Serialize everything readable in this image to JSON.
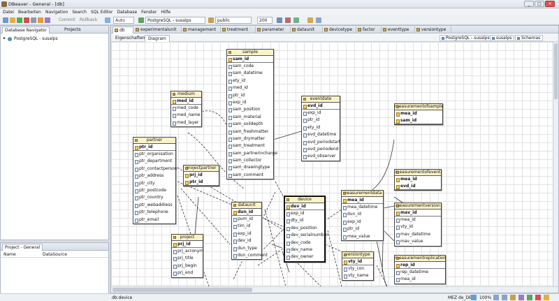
{
  "window": {
    "title": "DBeaver - General - [db]",
    "min_glyph": "_",
    "max_glyph": "□",
    "close_glyph": "×"
  },
  "menubar": [
    "Datei",
    "Bearbeiten",
    "Navigation",
    "Search",
    "SQL Editor",
    "Database",
    "Fenster",
    "Hilfe"
  ],
  "toolbar": {
    "commit_label": "Commit",
    "rollback_label": "Rollback",
    "auto_label": "Auto",
    "connection": "PostgreSQL - susalps",
    "schema": "public",
    "limit": "200"
  },
  "navigator": {
    "tabs": [
      "Database Navigator",
      "Projects"
    ],
    "tree": [
      {
        "label": "PostgreSQL - susalps"
      }
    ]
  },
  "project_panel": {
    "title": "Project - General",
    "columns": [
      "Name",
      "DataSource"
    ]
  },
  "editor": {
    "tabs": [
      "db",
      "experimentalunit",
      "management",
      "treatment",
      "parameter",
      "dataunit",
      "devicetype",
      "factor",
      "eventtype",
      "versiontype"
    ],
    "subtabs": [
      "Eigenschaften",
      "Diagram"
    ],
    "context": [
      "PostgreSQL - susalps",
      "susalps",
      "Schemas"
    ]
  },
  "diagram": {
    "entities": {
      "sample": {
        "title": "sample",
        "pk": "sam_id",
        "columns": [
          "sam_code",
          "sam_datetime",
          "ety_id",
          "med_id",
          "ptr_id",
          "exp_id",
          "sam_position",
          "sam_material",
          "sam_soildepth",
          "sam_freshmatter",
          "sam_drymatter",
          "sam_treatment",
          "sam_partnerincharge",
          "sam_collector",
          "sam_drawingtype",
          "sam_comment"
        ]
      },
      "medium": {
        "title": "medium",
        "pk": "med_id",
        "columns": [
          "med_code",
          "med_name",
          "med_layer"
        ]
      },
      "partner": {
        "title": "partner",
        "pk": "ptr_id",
        "columns": [
          "ptr_organisation",
          "ptr_department",
          "ptr_contactperson",
          "ptr_address",
          "ptr_city",
          "ptr_postcode",
          "ptr_country",
          "ptr_webaddress",
          "ptr_telephone",
          "ptr_email"
        ]
      },
      "projectpartner": {
        "title": "projectpartner",
        "pk": "prj_id",
        "columns": [
          "ptr_id"
        ]
      },
      "project": {
        "title": "project",
        "pk": "prj_id",
        "columns": [
          "prj_acronym",
          "prj_title",
          "prj_begin",
          "prj_end"
        ]
      },
      "eventdate": {
        "title": "eventdate",
        "pk": "evd_id",
        "columns": [
          "exp_id",
          "ptr_id",
          "ety_id",
          "evd_datetime",
          "evd_periodstart",
          "evd_periodend",
          "evd_observer"
        ]
      },
      "dataunit": {
        "title": "dataunit",
        "pk": "dun_id",
        "columns": [
          "pum_id",
          "tim_id",
          "exp_id",
          "dev_id",
          "dun_type",
          "dun_comment"
        ]
      },
      "device": {
        "title": "device",
        "pk": "dev_id",
        "columns": [
          "exp_id",
          "dty_id",
          "dev_position",
          "dev_serialnumber",
          "dev_code",
          "dev_name",
          "dev_owner"
        ]
      },
      "measurementdata": {
        "title": "measurementdata",
        "pk": "mea_id",
        "columns": [
          "mea_datetime",
          "dun_id",
          "exp_id",
          "ptr_id",
          "mea_value"
        ]
      },
      "measurementofsample": {
        "title": "measurementofsample",
        "pk": "mea_id",
        "columns": [
          "sam_id"
        ]
      },
      "measurementofevent": {
        "title": "measurementofevent",
        "pk": "mea_id",
        "columns": [
          "evd_id"
        ]
      },
      "measurementversion": {
        "title": "measurementversion",
        "pk": "mav_id",
        "columns": [
          "mea_id",
          "vty_id",
          "mav_datetime",
          "mav_value"
        ]
      },
      "versiontype": {
        "title": "versiontype",
        "pk": "vty_id",
        "columns": [
          "vty_con",
          "vty_name"
        ]
      },
      "measurementreplication": {
        "title": "measurementreplication",
        "pk": "rep_id",
        "columns": [
          "rep_datetime",
          "mea_id"
        ]
      }
    }
  },
  "statusbar": {
    "left": "db:device",
    "tz": "MEZ",
    "locale": "de_DE",
    "zoom": "100%"
  }
}
